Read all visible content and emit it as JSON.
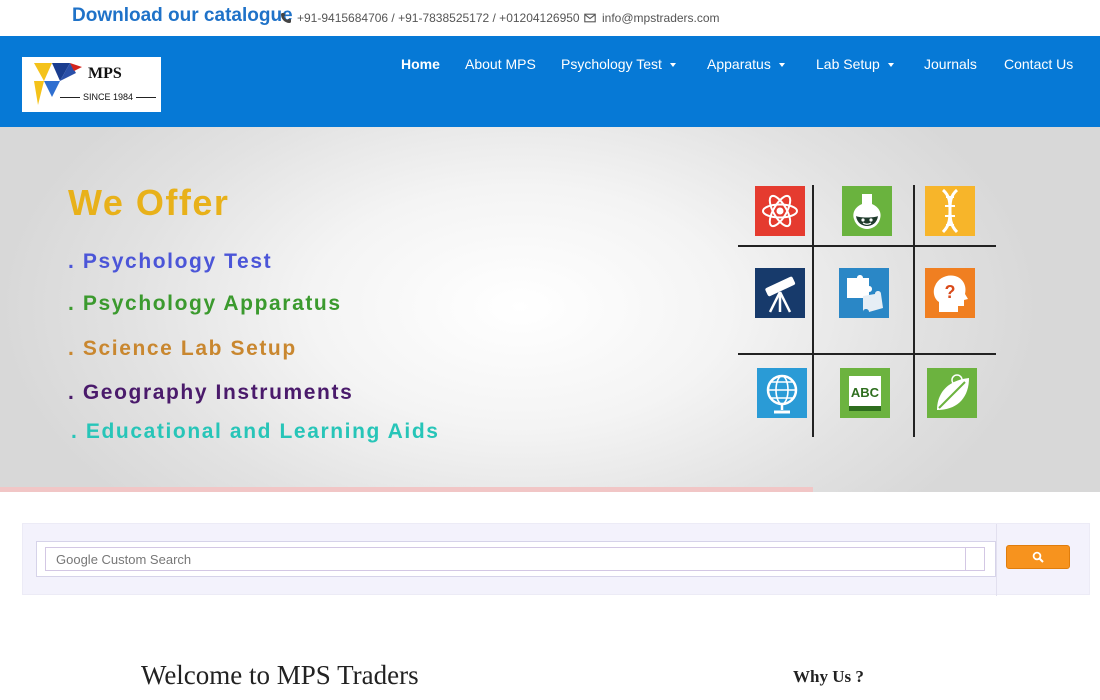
{
  "topbar": {
    "catalogue_link": "Download our catalogue",
    "phones": "+91-9415684706 / +91-7838525172 / +01204126950",
    "email": "info@mpstraders.com",
    "icons": {
      "phone": "phone-icon",
      "email": "envelope-icon"
    }
  },
  "logo": {
    "name": "MPS",
    "tagline": "SINCE 1984"
  },
  "nav": {
    "items": [
      {
        "label": "Home",
        "active": true,
        "dropdown": false
      },
      {
        "label": "About MPS",
        "active": false,
        "dropdown": false
      },
      {
        "label": "Psychology Test",
        "active": false,
        "dropdown": true
      },
      {
        "label": "Apparatus",
        "active": false,
        "dropdown": true
      },
      {
        "label": "Lab Setup",
        "active": false,
        "dropdown": true
      },
      {
        "label": "Journals",
        "active": false,
        "dropdown": false
      },
      {
        "label": "Contact Us",
        "active": false,
        "dropdown": false
      }
    ]
  },
  "hero": {
    "title": "We Offer",
    "offers": [
      {
        "text": ". Psychology Test",
        "color": "#4b55d8"
      },
      {
        "text": ". Psychology Apparatus",
        "color": "#3b9a2e"
      },
      {
        "text": ". Science Lab Setup",
        "color": "#c9872f"
      },
      {
        "text": ". Geography Instruments",
        "color": "#4a1a6b"
      },
      {
        "text": ". Educational and Learning Aids",
        "color": "#27c5b8"
      }
    ],
    "tiles": [
      {
        "icon": "atom-icon",
        "color": "#e53b2f"
      },
      {
        "icon": "flask-icon",
        "color": "#6ab33e"
      },
      {
        "icon": "dna-icon",
        "color": "#f7b52a"
      },
      {
        "icon": "telescope-icon",
        "color": "#173a6b"
      },
      {
        "icon": "puzzle-icon",
        "color": "#2a87c6"
      },
      {
        "icon": "head-question-icon",
        "color": "#f07f21"
      },
      {
        "icon": "globe-icon",
        "color": "#2a9bd6"
      },
      {
        "icon": "abc-book-icon",
        "color": "#6cb33f"
      },
      {
        "icon": "leaf-icon",
        "color": "#6cb33f"
      }
    ]
  },
  "search": {
    "placeholder_brand": "Google",
    "placeholder_text": "Custom Search",
    "placeholder": "Google Custom Search",
    "button_icon": "search-icon",
    "button_color": "#f7931e"
  },
  "content": {
    "welcome_heading": "Welcome to MPS Traders",
    "why_heading": "Why Us ?"
  },
  "colors": {
    "nav_bg": "#0679d6",
    "catalogue_link": "#1f72c8",
    "hero_title": "#e8b11a"
  }
}
